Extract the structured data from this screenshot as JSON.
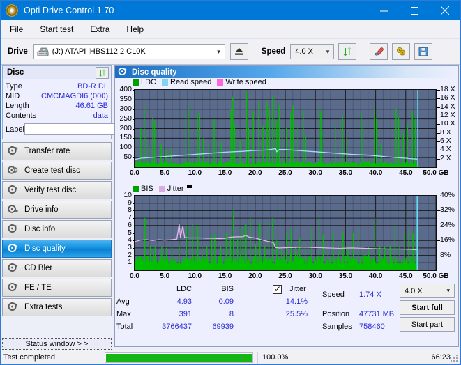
{
  "window": {
    "title": "Opti Drive Control 1.70",
    "app_icon": "disc-icon",
    "minimize": "minimize-icon",
    "maximize": "maximize-icon",
    "close": "close-icon"
  },
  "menu": [
    {
      "label": "File",
      "accel": "F"
    },
    {
      "label": "Start test",
      "accel": "S"
    },
    {
      "label": "Extra",
      "accel": "x"
    },
    {
      "label": "Help",
      "accel": "H"
    }
  ],
  "toolbar": {
    "drive_label": "Drive",
    "drive_value": "(J:)  ATAPI iHBS112  2 CL0K",
    "eject_icon": "eject-icon",
    "speed_label": "Speed",
    "speed_value": "4.0 X",
    "refresh_icon": "refresh-icon",
    "erase_icon": "eraser-icon",
    "tools_icon": "tools-icon",
    "save_icon": "save-icon"
  },
  "disc_panel": {
    "title": "Disc",
    "refresh_icon": "refresh-icon",
    "rows": [
      {
        "key": "Type",
        "value": "BD-R DL"
      },
      {
        "key": "MID",
        "value": "CMCMAGDI6 (000)"
      },
      {
        "key": "Length",
        "value": "46.61 GB"
      },
      {
        "key": "Contents",
        "value": "data"
      }
    ],
    "label_key": "Label",
    "label_value": "",
    "label_placeholder": "",
    "label_button_icon": "disc-label-icon"
  },
  "nav": {
    "items": [
      {
        "label": "Transfer rate",
        "icon": "disc-speed-icon",
        "selected": false
      },
      {
        "label": "Create test disc",
        "icon": "disc-create-icon",
        "selected": false
      },
      {
        "label": "Verify test disc",
        "icon": "disc-verify-icon",
        "selected": false
      },
      {
        "label": "Drive info",
        "icon": "drive-info-icon",
        "selected": false
      },
      {
        "label": "Disc info",
        "icon": "disc-info-icon",
        "selected": false
      },
      {
        "label": "Disc quality",
        "icon": "disc-quality-icon",
        "selected": true
      },
      {
        "label": "CD Bler",
        "icon": "cd-bler-icon",
        "selected": false
      },
      {
        "label": "FE / TE",
        "icon": "fe-te-icon",
        "selected": false
      },
      {
        "label": "Extra tests",
        "icon": "extra-tests-icon",
        "selected": false
      }
    ],
    "status_window": "Status window > >"
  },
  "panel": {
    "title": "Disc quality",
    "title_icon": "disc-quality-icon"
  },
  "chart_data": [
    {
      "id": "ldc-chart",
      "type": "line",
      "title": "Disc quality - LDC",
      "xlabel": "GB",
      "ylabel": "LDC",
      "xlim": [
        0,
        50
      ],
      "xticks": [
        "0.0",
        "5.0",
        "10.0",
        "15.0",
        "20.0",
        "25.0",
        "30.0",
        "35.0",
        "40.0",
        "45.0",
        "50.0 GB"
      ],
      "ylim": [
        0,
        400
      ],
      "yticks": [
        "400",
        "350",
        "300",
        "250",
        "200",
        "150",
        "100",
        "50"
      ],
      "y2lim": [
        0,
        18
      ],
      "y2ticks": [
        "18 X",
        "16 X",
        "14 X",
        "12 X",
        "10 X",
        "8 X",
        "6 X",
        "4 X",
        "2 X"
      ],
      "grid": true,
      "legend_position": "top-left",
      "legend": [
        {
          "name": "LDC",
          "color": "#00a000"
        },
        {
          "name": "Read speed",
          "color": "#7fd4f5"
        },
        {
          "name": "Write speed",
          "color": "#ff66dd"
        }
      ],
      "series": [
        {
          "name": "LDC",
          "color": "#00c000",
          "kind": "spikes",
          "baseline": 30,
          "x_end": 47.0,
          "peaks": [
            [
              1.0,
              200
            ],
            [
              1.6,
              318
            ],
            [
              1.9,
              160
            ],
            [
              2.4,
              110
            ],
            [
              3.0,
              255
            ],
            [
              3.3,
              238
            ],
            [
              4.4,
              120
            ],
            [
              5.2,
              90
            ],
            [
              6.1,
              100
            ],
            [
              8.5,
              280
            ],
            [
              8.9,
              323
            ],
            [
              10.4,
              275
            ],
            [
              10.8,
              281
            ],
            [
              11.4,
              150
            ],
            [
              12.3,
              120
            ],
            [
              13.2,
              248
            ],
            [
              13.5,
              135
            ],
            [
              14.4,
              130
            ],
            [
              16.0,
              300
            ],
            [
              16.3,
              365
            ],
            [
              16.6,
              218
            ],
            [
              17.5,
              140
            ],
            [
              18.6,
              390
            ],
            [
              18.9,
              205
            ],
            [
              19.7,
              290
            ],
            [
              20.6,
              340
            ],
            [
              21.3,
              215
            ],
            [
              22.0,
              340
            ],
            [
              22.4,
              300
            ],
            [
              22.9,
              370
            ],
            [
              23.3,
              355
            ],
            [
              23.6,
              240
            ],
            [
              24.0,
              320
            ],
            [
              24.5,
              200
            ],
            [
              25.2,
              205
            ],
            [
              25.9,
              280
            ],
            [
              26.3,
              320
            ],
            [
              27.1,
              225
            ],
            [
              28.0,
              295
            ],
            [
              28.4,
              165
            ],
            [
              30.6,
              310
            ],
            [
              30.9,
              290
            ],
            [
              31.4,
              180
            ],
            [
              33.3,
              225
            ],
            [
              34.1,
              250
            ],
            [
              34.5,
              265
            ],
            [
              35.2,
              150
            ],
            [
              37.6,
              285
            ],
            [
              37.9,
              230
            ],
            [
              39.8,
              298
            ],
            [
              40.1,
              250
            ],
            [
              41.0,
              120
            ],
            [
              43.4,
              300
            ],
            [
              43.8,
              260
            ],
            [
              44.6,
              180
            ],
            [
              45.3,
              220
            ],
            [
              46.1,
              290
            ],
            [
              46.6,
              250
            ]
          ]
        },
        {
          "name": "Read speed",
          "color": "#9fdcf7",
          "kind": "line",
          "points": [
            [
              0,
              1.8
            ],
            [
              1,
              2.1
            ],
            [
              3,
              2.3
            ],
            [
              6,
              2.6
            ],
            [
              9,
              2.9
            ],
            [
              12,
              3.2
            ],
            [
              15,
              3.5
            ],
            [
              18,
              3.7
            ],
            [
              20,
              3.9
            ],
            [
              22,
              4.0
            ],
            [
              23.4,
              4.3
            ],
            [
              23.6,
              3.6
            ],
            [
              24,
              4.1
            ],
            [
              25,
              4.1
            ],
            [
              26,
              4.0
            ],
            [
              28,
              3.8
            ],
            [
              30,
              3.6
            ],
            [
              33,
              3.3
            ],
            [
              36,
              3.0
            ],
            [
              39,
              2.8
            ],
            [
              42,
              2.4
            ],
            [
              45,
              2.1
            ],
            [
              46.9,
              1.9
            ]
          ]
        },
        {
          "name": "Write speed",
          "color": "#ff66dd",
          "kind": "none",
          "points": []
        }
      ],
      "marker_line": {
        "x": 47.0,
        "color": "#66d9f5"
      }
    },
    {
      "id": "bis-jitter-chart",
      "type": "line",
      "title": "Disc quality - BIS / Jitter",
      "xlabel": "GB",
      "ylabel": "BIS",
      "xlim": [
        0,
        50
      ],
      "xticks": [
        "0.0",
        "5.0",
        "10.0",
        "15.0",
        "20.0",
        "25.0",
        "30.0",
        "35.0",
        "40.0",
        "45.0",
        "50.0 GB"
      ],
      "ylim": [
        0,
        10
      ],
      "yticks": [
        "10",
        "9",
        "8",
        "7",
        "6",
        "5",
        "4",
        "3",
        "2",
        "1"
      ],
      "y2lim": [
        0,
        40
      ],
      "y2ticks": [
        "40%",
        "32%",
        "24%",
        "16%",
        "8%"
      ],
      "grid": true,
      "legend_position": "top-left",
      "legend": [
        {
          "name": "BIS",
          "color": "#00a000"
        },
        {
          "name": "Jitter",
          "color": "#d8aee0"
        }
      ],
      "series": [
        {
          "name": "BIS",
          "color": "#00c000",
          "kind": "spikes",
          "baseline": 2.0,
          "x_end": 46.9,
          "peaks": [
            [
              1.7,
              7.0
            ],
            [
              2.6,
              3.3
            ],
            [
              3.4,
              3.1
            ],
            [
              4.5,
              3.2
            ],
            [
              5.3,
              3.0
            ],
            [
              6.2,
              3.1
            ],
            [
              7.4,
              3.4
            ],
            [
              8.6,
              6.0
            ],
            [
              9.2,
              6.0
            ],
            [
              9.6,
              6.1
            ],
            [
              10.5,
              5.9
            ],
            [
              11.2,
              3.2
            ],
            [
              12.0,
              3.1
            ],
            [
              12.8,
              4.6
            ],
            [
              13.3,
              4.8
            ],
            [
              14.3,
              3.1
            ],
            [
              15.2,
              5.0
            ],
            [
              15.9,
              4.3
            ],
            [
              16.4,
              8.0
            ],
            [
              17.1,
              4.3
            ],
            [
              17.6,
              5.5
            ],
            [
              18.0,
              5.6
            ],
            [
              18.5,
              6.2
            ],
            [
              19.2,
              7.0
            ],
            [
              20.1,
              3.5
            ],
            [
              20.8,
              6.4
            ],
            [
              21.6,
              3.3
            ],
            [
              22.3,
              7.0
            ],
            [
              22.9,
              7.0
            ],
            [
              23.6,
              4.0
            ],
            [
              24.4,
              3.2
            ],
            [
              25.2,
              5.0
            ],
            [
              26.0,
              5.5
            ],
            [
              26.7,
              3.2
            ],
            [
              27.4,
              4.3
            ],
            [
              28.3,
              3.3
            ],
            [
              29.4,
              5.5
            ],
            [
              30.6,
              7.0
            ],
            [
              31.3,
              4.8
            ],
            [
              32.1,
              3.2
            ],
            [
              33.0,
              5.0
            ],
            [
              33.8,
              3.4
            ],
            [
              34.6,
              5.0
            ],
            [
              35.4,
              3.3
            ],
            [
              36.3,
              5.0
            ],
            [
              37.1,
              5.5
            ],
            [
              37.9,
              3.3
            ],
            [
              38.8,
              3.2
            ],
            [
              39.9,
              7.0
            ],
            [
              40.7,
              3.3
            ],
            [
              41.5,
              3.2
            ],
            [
              42.4,
              3.3
            ],
            [
              43.2,
              6.0
            ],
            [
              44.0,
              3.4
            ],
            [
              44.8,
              5.0
            ],
            [
              45.5,
              5.5
            ],
            [
              46.2,
              5.0
            ],
            [
              46.7,
              5.4
            ]
          ]
        },
        {
          "name": "Jitter",
          "color": "#e3b9ea",
          "kind": "line",
          "points": [
            [
              0,
              3.85
            ],
            [
              1,
              4.05
            ],
            [
              2,
              4.1
            ],
            [
              3,
              4.0
            ],
            [
              4,
              4.1
            ],
            [
              5,
              4.05
            ],
            [
              6,
              4.1
            ],
            [
              7,
              4.2
            ],
            [
              7.4,
              6.2
            ],
            [
              7.6,
              4.4
            ],
            [
              8.0,
              5.9
            ],
            [
              8.3,
              4.4
            ],
            [
              9,
              4.35
            ],
            [
              10,
              4.35
            ],
            [
              11,
              4.35
            ],
            [
              12,
              4.3
            ],
            [
              13,
              4.3
            ],
            [
              14,
              4.25
            ],
            [
              15,
              4.3
            ],
            [
              16,
              4.45
            ],
            [
              17,
              4.5
            ],
            [
              18,
              4.5
            ],
            [
              18.4,
              4.7
            ],
            [
              19,
              4.45
            ],
            [
              20,
              4.35
            ],
            [
              21,
              4.1
            ],
            [
              22,
              3.9
            ],
            [
              23,
              3.7
            ],
            [
              23.4,
              3.05
            ],
            [
              24,
              3.0
            ],
            [
              26,
              3.05
            ],
            [
              28,
              3.1
            ],
            [
              30,
              3.05
            ],
            [
              32,
              3.0
            ],
            [
              34,
              2.95
            ],
            [
              36,
              3.0
            ],
            [
              38,
              2.95
            ],
            [
              40,
              2.9
            ],
            [
              42,
              2.85
            ],
            [
              44,
              2.85
            ],
            [
              46,
              2.8
            ],
            [
              46.9,
              2.75
            ]
          ]
        }
      ],
      "marker_line": {
        "x": 46.9,
        "color": "#66d9f5"
      }
    }
  ],
  "stats": {
    "col_headers": [
      "LDC",
      "BIS"
    ],
    "row_labels": [
      "Avg",
      "Max",
      "Total"
    ],
    "ldc": {
      "avg": "4.93",
      "max": "391",
      "total": "3766437"
    },
    "bis": {
      "avg": "0.09",
      "max": "8",
      "total": "69939"
    },
    "jitter": {
      "label": "Jitter",
      "checked": true,
      "avg": "14.1%",
      "max": "25.5%"
    },
    "speed_label": "Speed",
    "speed_value": "1.74 X",
    "position_label": "Position",
    "position_value": "47731 MB",
    "samples_label": "Samples",
    "samples_value": "758460",
    "speed_select": "4.0 X",
    "start_full": "Start full",
    "start_part": "Start part"
  },
  "statusbar": {
    "message": "Test completed",
    "progress_percent": 100,
    "progress_text": "100.0%",
    "elapsed": "66:23"
  },
  "colors": {
    "accent": "#0078d7",
    "plot_bg": "#5a6b8c",
    "ldc_green": "#00c000",
    "read_speed": "#9fdcf7",
    "write_speed": "#ff66dd",
    "jitter": "#e3b9ea",
    "value_blue": "#2b2bd4",
    "progress_green": "#14b514"
  }
}
